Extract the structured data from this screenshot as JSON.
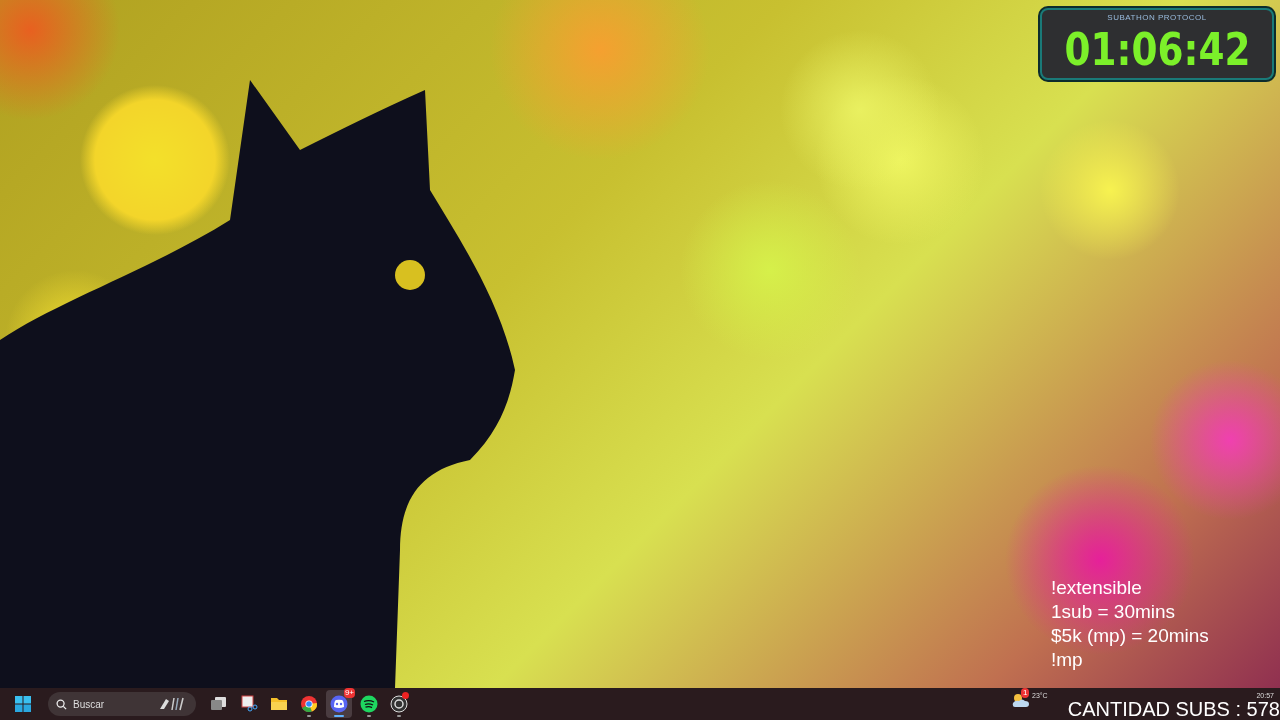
{
  "timer": {
    "caption": "SUBATHON PROTOCOL",
    "time": "01:06:42"
  },
  "overlay_notes": [
    "!extensible",
    "1sub = 30mins",
    "$5k (mp) = 20mins",
    "!mp"
  ],
  "taskbar": {
    "search": {
      "placeholder": "Buscar"
    },
    "apps": [
      {
        "kind": "taskview",
        "running": false,
        "selected": false
      },
      {
        "kind": "snip",
        "running": false,
        "selected": false
      },
      {
        "kind": "folder",
        "running": false,
        "selected": false
      },
      {
        "kind": "chrome",
        "running": true,
        "selected": false
      },
      {
        "kind": "discord",
        "running": true,
        "selected": true,
        "badge": "9+"
      },
      {
        "kind": "spotify",
        "running": true,
        "selected": false
      },
      {
        "kind": "obs",
        "running": true,
        "selected": false,
        "alert": true
      }
    ],
    "tray": {
      "weather_badge": "1",
      "temperature": "23°C",
      "time": "20:57"
    }
  },
  "subs_counter": "CANTIDAD SUBS : 578"
}
